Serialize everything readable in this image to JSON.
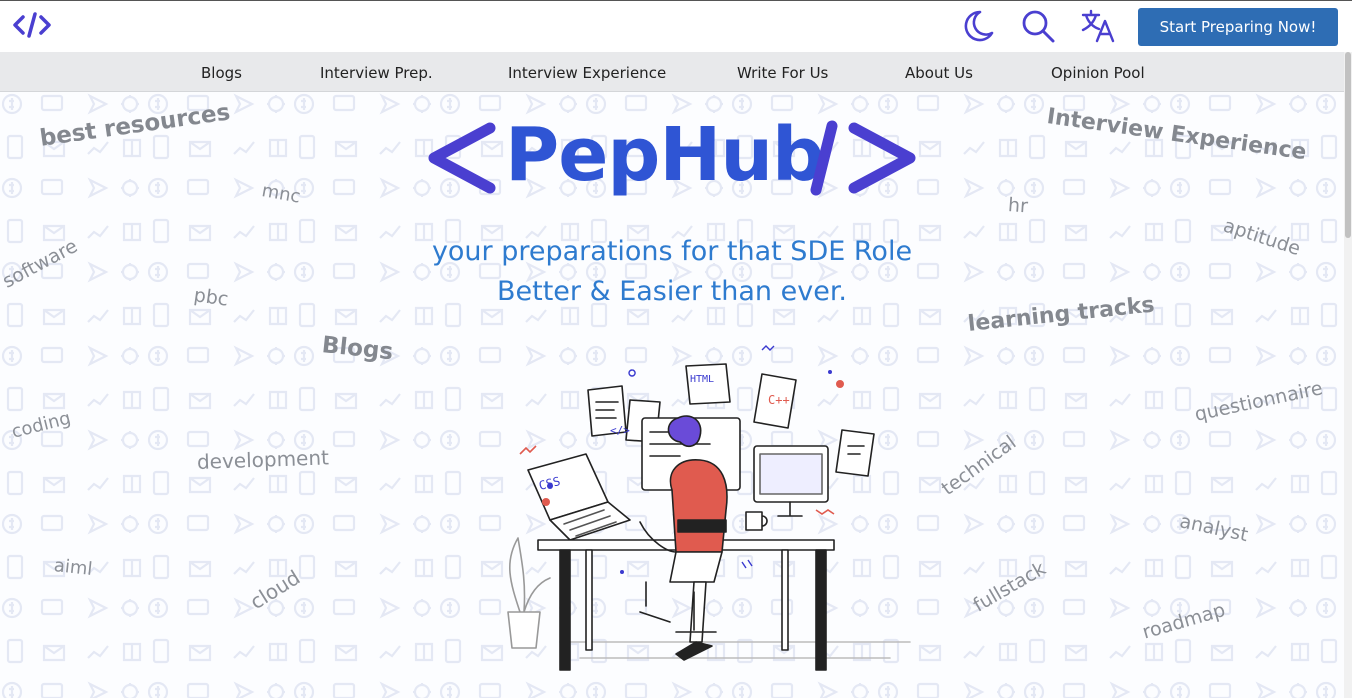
{
  "header": {
    "logo_icon": "code-brackets-icon",
    "theme_icon": "moon-icon",
    "search_icon": "search-icon",
    "translate_icon": "translate-icon",
    "cta_label": "Start Preparing Now!",
    "cta_color": "#2e6db4"
  },
  "nav": {
    "items": [
      "Blogs",
      "Interview Prep.",
      "Interview Experience",
      "Write For Us",
      "About Us",
      "Opinion Pool"
    ]
  },
  "hero": {
    "brand": "PepHub",
    "brand_color": "#2f55d4",
    "bracket_color": "#4a3fd0",
    "tagline_line1": "your preparations for that SDE Role",
    "tagline_line2": "Better & Easier than ever.",
    "tagline_color": "#2e7bcf",
    "illustration": {
      "laptop_text": "CSS",
      "note_html": "HTML",
      "note_cpp": "C++",
      "code_tag": "</>"
    }
  },
  "keywords": [
    "best resources",
    "mnc",
    "software",
    "pbc",
    "Blogs",
    "coding",
    "development",
    "aiml",
    "cloud",
    "Interview Experience",
    "hr",
    "aptitude",
    "learning tracks",
    "questionnaire",
    "technical",
    "analyst",
    "fullstack",
    "roadmap"
  ]
}
